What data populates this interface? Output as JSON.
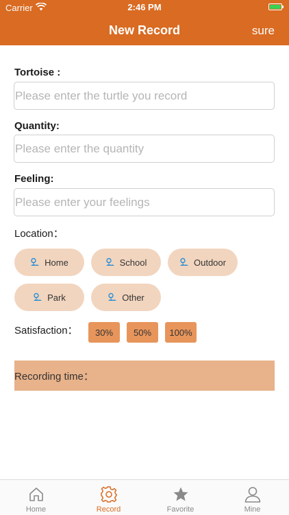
{
  "status": {
    "carrier": "Carrier",
    "time": "2:46 PM"
  },
  "nav": {
    "title": "New Record",
    "action": "sure"
  },
  "form": {
    "tortoise": {
      "label": "Tortoise :",
      "placeholder": "Please enter the turtle you record"
    },
    "quantity": {
      "label": "Quantity:",
      "placeholder": "Please enter the quantity"
    },
    "feeling": {
      "label": "Feeling:",
      "placeholder": "Please enter your feelings"
    },
    "location_label": "Location：",
    "locations": [
      "Home",
      "School",
      "Outdoor",
      "Park",
      "Other"
    ],
    "satisfaction_label": "Satisfaction：",
    "satisfaction_options": [
      "30%",
      "50%",
      "100%"
    ],
    "recording_time_label": "Recording time："
  },
  "tabs": [
    {
      "label": "Home",
      "icon": "home-icon"
    },
    {
      "label": "Record",
      "icon": "gear-icon"
    },
    {
      "label": "Favorite",
      "icon": "star-icon"
    },
    {
      "label": "Mine",
      "icon": "user-icon"
    }
  ],
  "colors": {
    "accent": "#d96b22",
    "chip": "#f2d5bf",
    "percent": "#e8955b",
    "time_bar": "#e8b28a",
    "pin": "#2a8fd6"
  }
}
